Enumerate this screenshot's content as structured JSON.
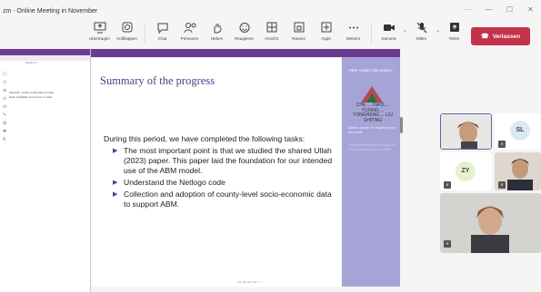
{
  "window": {
    "title": "zm - Online Meeting in November",
    "controls": [
      "···",
      "—",
      "☐",
      "✕"
    ]
  },
  "toolbar": {
    "items": [
      {
        "label": "Ubertragen",
        "icon": "share-screen-icon"
      },
      {
        "label": "Aufklappen",
        "icon": "camera-ar-icon"
      },
      {
        "label": "Chat",
        "icon": "chat-icon"
      },
      {
        "label": "Personen",
        "icon": "people-icon",
        "badge": "5"
      },
      {
        "label": "Heben",
        "icon": "raise-hand-icon"
      },
      {
        "label": "Reagieren",
        "icon": "react-icon"
      },
      {
        "label": "Ansicht",
        "icon": "view-grid-icon"
      },
      {
        "label": "Raume",
        "icon": "rooms-icon"
      },
      {
        "label": "Apps",
        "icon": "apps-icon"
      },
      {
        "label": "Weitere",
        "icon": "more-icon"
      },
      {
        "label": "Kamera",
        "icon": "camera-icon"
      },
      {
        "label": "Mikro",
        "icon": "mic-off-icon"
      },
      {
        "label": "Teilen",
        "icon": "share-icon"
      }
    ],
    "leave_label": "Verlassen",
    "leave_color": "#c4314b"
  },
  "document": {
    "tab_label": "section 6",
    "lines": [
      "Methods: model configuration & data",
      "Data availability and access to data"
    ]
  },
  "slide": {
    "title": "Summary of the progress",
    "intro": "During this period, we have completed the following tasks:",
    "bullets": [
      "The most important point is that we studied the shared Ullah (2023) paper. This paper laid the foundation for our intended use of the ABM model.",
      "Understand the Netlogo code",
      "Collection and adoption of county-level socio-economic data to support ABM."
    ],
    "footer_nav": "◂ ▸ ◂ ▸ ◂ ▸ ◂ ▸ ≡ ∽",
    "accent": "#4a3f86"
  },
  "side_panel": {
    "heading": "ABM model discussion",
    "names": "CHE ... XIAOL... YUXING ... YONGHENG ... LIU SHITING",
    "note1": "Model update on ongoing work and code",
    "note2": "Data availability and discussion of data preparation for ABM"
  },
  "participants": [
    {
      "initials": "",
      "kind": "video-self"
    },
    {
      "initials": "SL",
      "kind": "avatar"
    },
    {
      "initials": "ZY",
      "kind": "avatar"
    },
    {
      "initials": "",
      "kind": "video"
    },
    {
      "initials": "",
      "kind": "video"
    }
  ]
}
